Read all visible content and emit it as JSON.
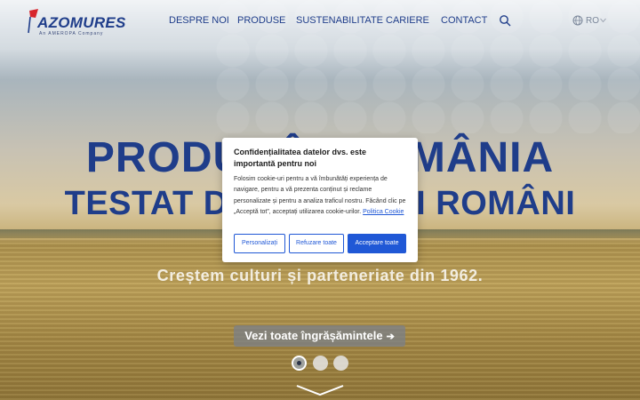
{
  "brand": {
    "name": "AZOMURES",
    "subtitle": "An AMEROPA Company"
  },
  "nav": {
    "items": [
      {
        "label": "DESPRE NOI"
      },
      {
        "label": "PRODUSE"
      },
      {
        "label": "SUSTENABILITATE"
      },
      {
        "label": "CARIERE"
      },
      {
        "label": "CONTACT"
      }
    ],
    "language": "RO"
  },
  "hero": {
    "line1": "PRODUȘ ÎN ROMÂNIA",
    "line2": "TESTAT DE FERMIERI ROMÂNI",
    "tagline": "Creștem culturi și parteneriate din 1962.",
    "cta": "Vezi toate îngrășămintele"
  },
  "carousel": {
    "slides": 3,
    "active": 1
  },
  "cookie": {
    "title": "Confidențialitatea datelor dvs. este importantă pentru noi",
    "body": "Folosim cookie-uri pentru a vă îmbunătăți experiența de navigare, pentru a vă prezenta conținut și reclame personalizate și pentru a analiza traficul nostru. Făcând clic pe „Acceptă tot”, acceptați utilizarea cookie-urilor.",
    "policy_link": "Politica Cookie",
    "btn_customize": "Personalizați",
    "btn_reject": "Refuzare toate",
    "btn_accept": "Acceptare toate"
  },
  "colors": {
    "brand_blue": "#1f3d8a",
    "button_blue": "#2058d6",
    "logo_red": "#d7262d"
  }
}
